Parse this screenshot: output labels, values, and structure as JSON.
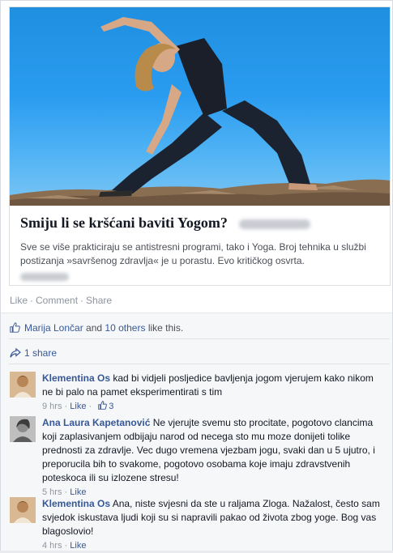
{
  "card": {
    "title": "Smiju li se kršćani baviti Yogom?",
    "description": "Sve se više prakticiraju se antistresni programi, tako i Yoga. Broj tehnika u službi postizanja »savršenog zdravlja« je u porastu. Evo kritičkog osvrta."
  },
  "actions": {
    "like": "Like",
    "comment": "Comment",
    "share": "Share",
    "separator": "·"
  },
  "likes": {
    "user": "Marija Lončar",
    "and": "and",
    "others": "10 others",
    "suffix": "like this."
  },
  "shares": {
    "label": "1 share"
  },
  "comments": [
    {
      "name": "Klementina Os",
      "text": "kad bi vidjeli posljedice bavljenja jogom vjerujem kako nikom ne bi palo na pamet eksperimentirati s tim",
      "time": "9 hrs",
      "like": "Like",
      "like_count": "3"
    },
    {
      "name": "Ana Laura Kapetanović",
      "text": "Ne vjerujte svemu sto procitate, pogotovo clancima koji zaplasivanjem odbijaju narod od necega sto mu moze donijeti tolike prednosti za zdravlje. Vec dugo vremena vjezbam jogu, svaki dan u 5 ujutro, i preporucila bih to svakome, pogotovo osobama koje imaju zdravstvenih poteskoca ili su izlozene stresu!",
      "time": "5 hrs",
      "like": "Like"
    },
    {
      "name": "Klementina Os",
      "text": "Ana, niste svjesni da ste u raljama Zloga. Nažalost, često sam svjedok iskustava ljudi koji su si napravili pakao od života zbog yoge. Bog vas blagoslovio!",
      "time": "4 hrs",
      "like": "Like"
    }
  ]
}
